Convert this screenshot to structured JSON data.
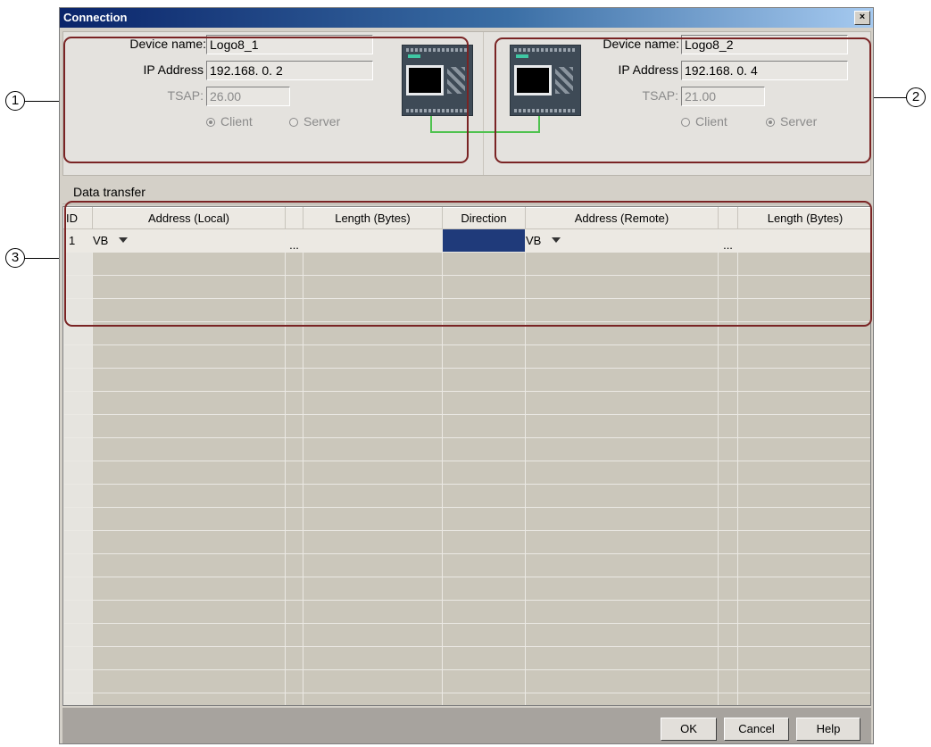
{
  "window": {
    "title": "Connection",
    "close_glyph": "×"
  },
  "local": {
    "device_name_label": "Device name:",
    "device_name": "Logo8_1",
    "ip_label": "IP Address",
    "ip": "192.168.  0.  2",
    "tsap_label": "TSAP:",
    "tsap": "26.00",
    "client_label": "Client",
    "server_label": "Server",
    "mode": "Client"
  },
  "remote": {
    "device_name_label": "Device name:",
    "device_name": "Logo8_2",
    "ip_label": "IP Address",
    "ip": "192.168.  0.  4",
    "tsap_label": "TSAP:",
    "tsap": "21.00",
    "client_label": "Client",
    "server_label": "Server",
    "mode": "Server"
  },
  "data_transfer": {
    "title": "Data transfer",
    "columns": [
      "ID",
      "Address (Local)",
      "",
      "Length (Bytes)",
      "Direction",
      "Address (Remote)",
      "",
      "Length (Bytes)"
    ],
    "rows": [
      {
        "id": "1",
        "address_local": "VB",
        "browse_local": "...",
        "length_local": "",
        "direction": "",
        "address_remote": "VB",
        "browse_remote": "...",
        "length_remote": ""
      }
    ]
  },
  "callouts": [
    "1",
    "2",
    "3"
  ],
  "buttons": {
    "ok": "OK",
    "cancel": "Cancel",
    "help": "Help"
  },
  "colors": {
    "title_start": "#0a246a",
    "selection": "#1f3a7a",
    "highlight_border": "#7a2424",
    "link_line": "#4fc24f"
  }
}
